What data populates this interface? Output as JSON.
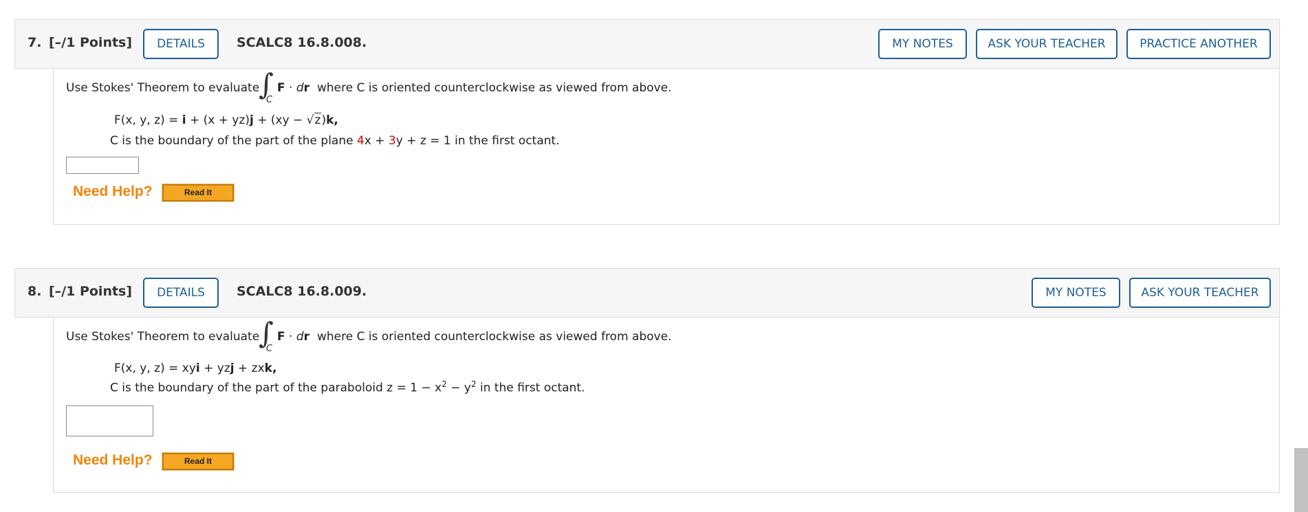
{
  "questions": [
    {
      "number": "7.",
      "points": "[–/1 Points]",
      "details_label": "DETAILS",
      "code": "SCALC8 16.8.008.",
      "buttons": {
        "my_notes": "MY NOTES",
        "ask_teacher": "ASK YOUR TEACHER",
        "practice_another": "PRACTICE ANOTHER"
      },
      "prompt_before": "Use Stokes' Theorem to evaluate",
      "integral_sub": "C",
      "prompt_after": "where C is oriented counterclockwise as viewed from above.",
      "field": {
        "lhs": "F(x, y, z) =",
        "p1": "i",
        "p2": " + (x + yz)",
        "p3": "j",
        "p4": " + (xy − ",
        "sqrt_arg": "z",
        "p5": ")",
        "p6": "k,"
      },
      "curve": {
        "pre": "C is the boundary of the part of the plane",
        "c1": "4",
        "mid1": "x + ",
        "c2": "3",
        "mid2": "y + z = 1",
        "post": "in the first octant."
      },
      "answer_value": "",
      "need_help": "Need Help?",
      "read_it": "Read It"
    },
    {
      "number": "8.",
      "points": "[–/1 Points]",
      "details_label": "DETAILS",
      "code": "SCALC8 16.8.009.",
      "buttons": {
        "my_notes": "MY NOTES",
        "ask_teacher": "ASK YOUR TEACHER"
      },
      "prompt_before": "Use Stokes' Theorem to evaluate",
      "integral_sub": "C",
      "prompt_after": "where C is oriented counterclockwise as viewed from above.",
      "field": {
        "lhs": "F(x, y, z) = xy",
        "p1": "i",
        "p2": " + yz",
        "p3": "j",
        "p4": " + zx",
        "p5": "k,"
      },
      "curve": {
        "pre": "C is the boundary of the part of the paraboloid",
        "eq": "z = 1 − x",
        "exp1": "2",
        "eq2": " − y",
        "exp2": "2",
        "post": "in the first octant."
      },
      "answer_value": "",
      "need_help": "Need Help?",
      "read_it": "Read It"
    }
  ],
  "colors": {
    "button_border": "#1e5e97",
    "need_help": "#f0850a",
    "read_it_bg": "#f5a623",
    "coefficient_red": "#e00000",
    "header_bg": "#f6f6f6"
  }
}
